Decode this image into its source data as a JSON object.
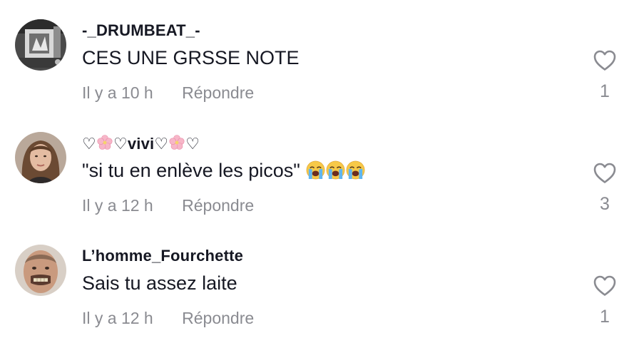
{
  "comments": [
    {
      "username": "-_DRUMBEAT_-",
      "text": "CES UNE GRSSE NOTE",
      "time": "Il y a 10 h",
      "reply_label": "Répondre",
      "likes": "1",
      "avatar_icon": "abstract-photo-avatar"
    },
    {
      "username_parts": [
        "♡",
        "♡vivi♡",
        "♡"
      ],
      "username_icons": [
        "cherry-blossom-icon",
        "cherry-blossom-icon"
      ],
      "text": "\"si tu en enlève les picos\" ",
      "text_emojis": [
        "loudly-crying-face-emoji",
        "loudly-crying-face-emoji",
        "loudly-crying-face-emoji"
      ],
      "time": "Il y a 12 h",
      "reply_label": "Répondre",
      "likes": "3",
      "avatar_icon": "woman-portrait-avatar"
    },
    {
      "username": "L’homme_Fourchette",
      "text": "Sais tu assez laite",
      "time": "Il y a 12 h",
      "reply_label": "Répondre",
      "likes": "1",
      "avatar_icon": "man-portrait-avatar"
    }
  ],
  "colors": {
    "primary_text": "#161823",
    "secondary_text": "#8a8b91",
    "background": "#ffffff"
  }
}
